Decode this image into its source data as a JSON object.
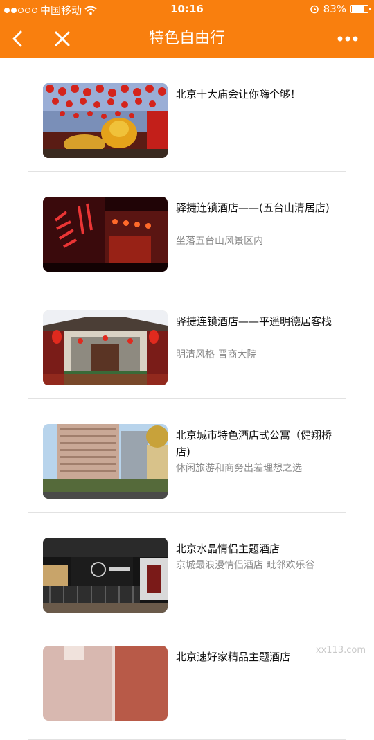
{
  "status_bar": {
    "carrier": "中国移动",
    "time": "10:16",
    "battery_percent": "83%",
    "battery_level": 0.83,
    "icons": [
      "signal-dots-icon",
      "wifi-icon",
      "alarm-icon",
      "battery-icon"
    ]
  },
  "nav": {
    "title": "特色自由行",
    "icons": [
      "back-arrow-icon",
      "close-icon",
      "more-icon"
    ]
  },
  "items": [
    {
      "title": "北京十大庙会让你嗨个够！",
      "desc": ""
    },
    {
      "title": "驿捷连锁酒店——(五台山清居店)",
      "desc": "坐落五台山风景区内"
    },
    {
      "title": "驿捷连锁酒店——平遥明德居客栈",
      "desc": "明清风格 晋商大院"
    },
    {
      "title": "北京城市特色酒店式公寓（健翔桥店)",
      "desc": "休闲旅游和商务出差理想之选"
    },
    {
      "title": "北京水晶情侣主题酒店",
      "desc": "京城最浪漫情侣酒店 毗邻欢乐谷"
    },
    {
      "title": "北京速好家精品主题酒店",
      "desc": ""
    }
  ],
  "watermark": "xx113.com",
  "colors": {
    "accent": "#f97f0e"
  }
}
